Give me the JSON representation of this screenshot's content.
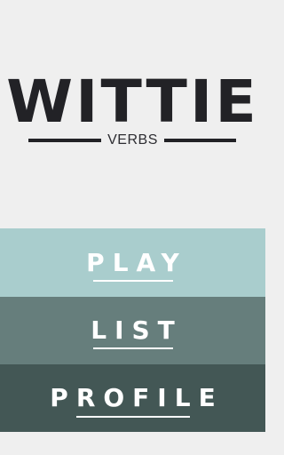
{
  "logo": {
    "title": "WITTIE",
    "subtitle": "VERBS"
  },
  "menu": {
    "play_label": "PLAY",
    "list_label": "LIST",
    "profile_label": "PROFILE"
  },
  "colors": {
    "background": "#efefef",
    "logo_text": "#222226",
    "play_band": "#a9cdcd",
    "list_band": "#667e7c",
    "profile_band": "#435755",
    "menu_text": "#ffffff"
  }
}
